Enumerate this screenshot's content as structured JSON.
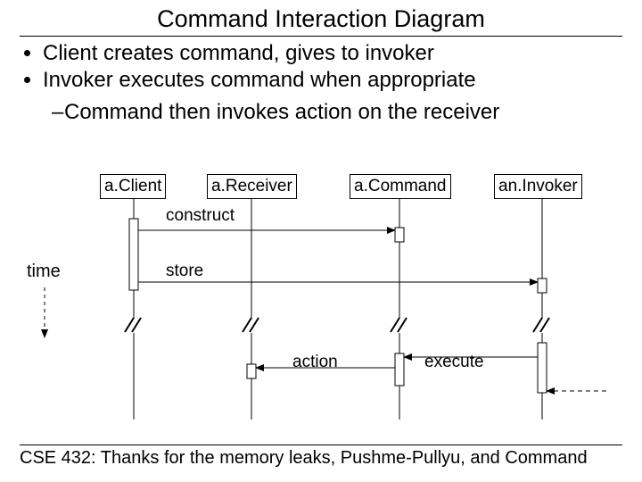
{
  "title": "Command Interaction Diagram",
  "bullets": {
    "b1": "Client creates command, gives to invoker",
    "b2": "Invoker executes command when appropriate",
    "sub": "Command then invokes action on the receiver"
  },
  "participants": {
    "client": "a.Client",
    "receiver": "a.Receiver",
    "command": "a.Command",
    "invoker": "an.Invoker"
  },
  "messages": {
    "construct": "construct",
    "store": "store",
    "action": "action",
    "execute": "execute"
  },
  "time_label": "time",
  "footer": "CSE 432: Thanks for the memory leaks, Pushme-Pullyu, and Command"
}
